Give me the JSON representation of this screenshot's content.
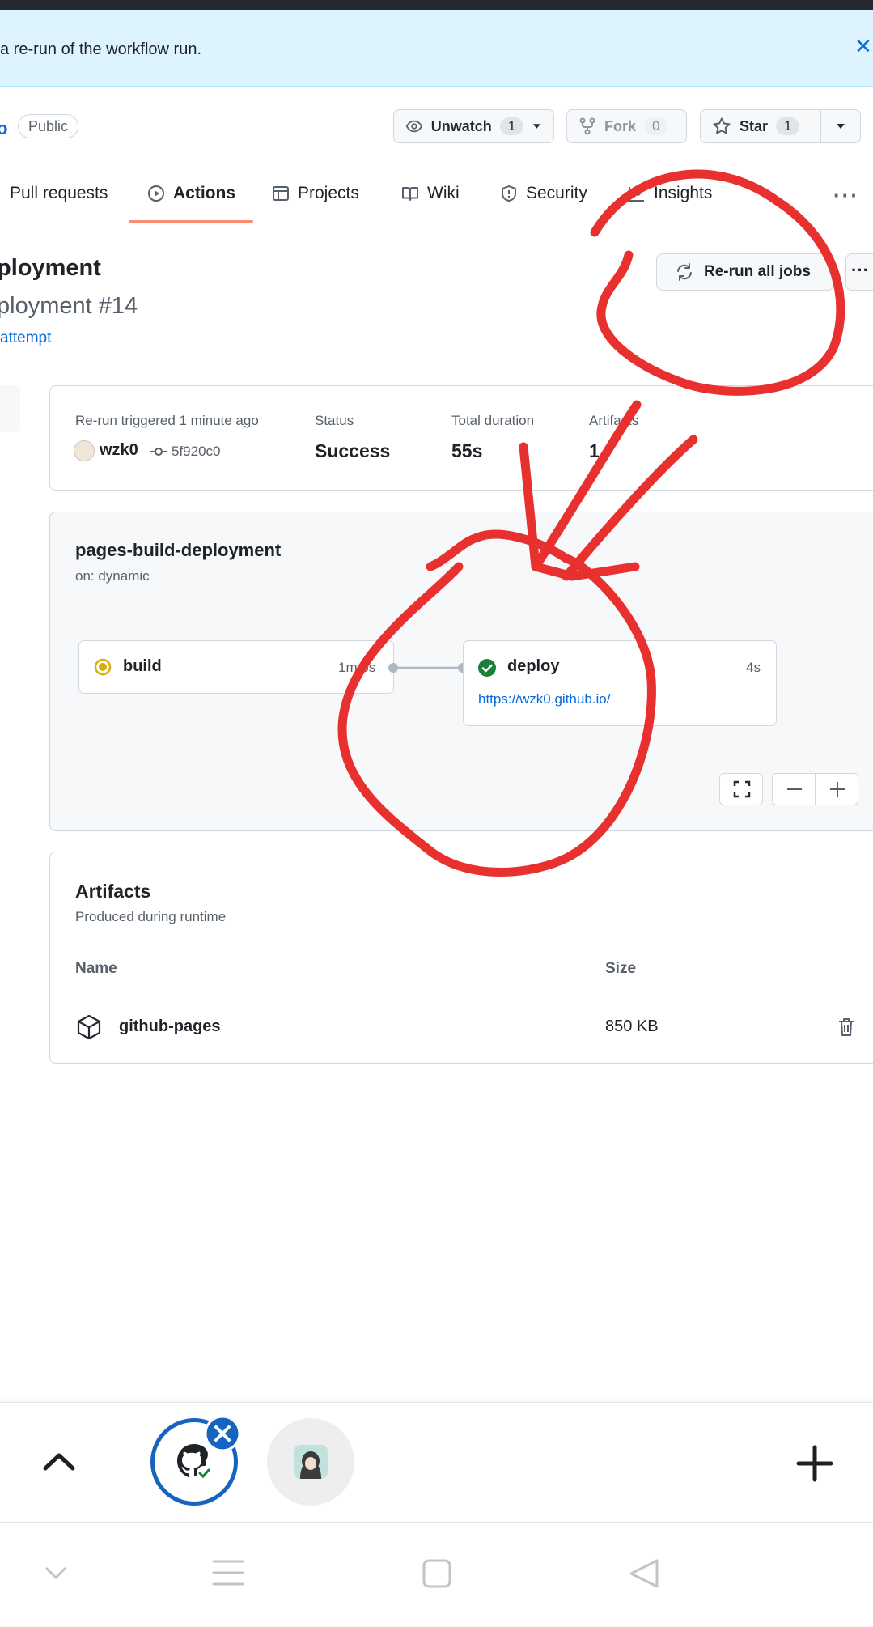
{
  "flash": {
    "message": "a re-run of the workflow run.",
    "close_icon": "close-icon"
  },
  "repo": {
    "visibility": "Public",
    "unwatch_label": "Unwatch",
    "unwatch_count": "1",
    "fork_label": "Fork",
    "fork_count": "0",
    "star_label": "Star",
    "star_count": "1"
  },
  "nav": {
    "tabs": [
      {
        "label": "Pull requests",
        "icon": "pull-request-icon"
      },
      {
        "label": "Actions",
        "icon": "play-icon",
        "active": true
      },
      {
        "label": "Projects",
        "icon": "table-icon"
      },
      {
        "label": "Wiki",
        "icon": "book-icon"
      },
      {
        "label": "Security",
        "icon": "shield-icon"
      },
      {
        "label": "Insights",
        "icon": "graph-icon"
      }
    ],
    "more_icon": "kebab-icon"
  },
  "run": {
    "title": "ployment",
    "subtitle": "ployment #14",
    "attempt_link": "attempt",
    "rerun_label": "Re-run all jobs",
    "more_label": "···"
  },
  "summary": {
    "trigger_label": "Re-run triggered 1 minute ago",
    "user": "wzk0",
    "commit": "5f920c0",
    "status_label": "Status",
    "status_value": "Success",
    "duration_label": "Total duration",
    "duration_value": "55s",
    "artifacts_label": "Artifacts",
    "artifacts_value": "1"
  },
  "workflow": {
    "name": "pages-build-deployment",
    "trigger": "on: dynamic",
    "jobs": [
      {
        "name": "build",
        "duration": "1m 5s",
        "status": "in-progress"
      },
      {
        "name": "deploy",
        "duration": "4s",
        "status": "success",
        "link": "https://wzk0.github.io/"
      }
    ]
  },
  "artifacts": {
    "title": "Artifacts",
    "subtitle": "Produced during runtime",
    "col_name": "Name",
    "col_size": "Size",
    "rows": [
      {
        "name": "github-pages",
        "size": "850 KB"
      }
    ]
  },
  "colors": {
    "accent": "#0969da",
    "success": "#1a7f37",
    "in_progress": "#dbab0a",
    "annotation": "#e8312f",
    "tab_underline": "#fd8c73",
    "flash_bg": "#ddf4ff"
  }
}
